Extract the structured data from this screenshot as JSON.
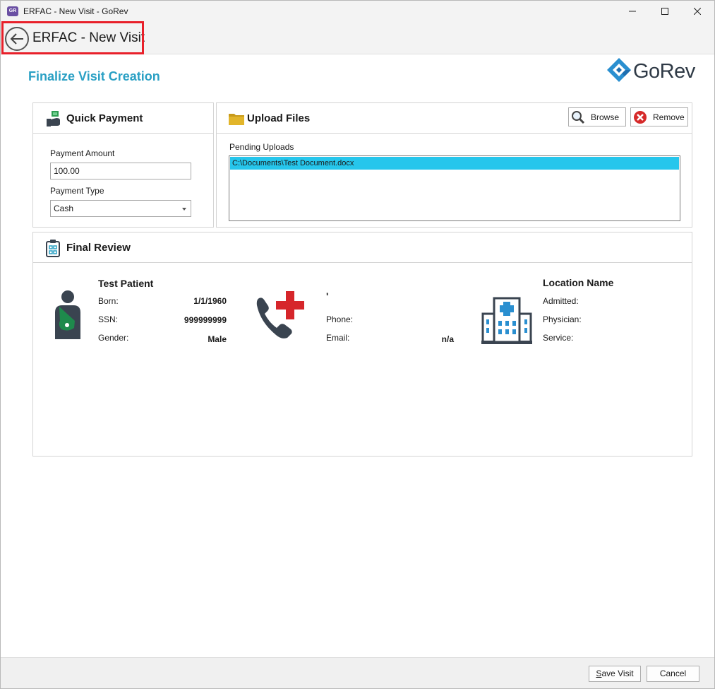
{
  "window": {
    "title": "ERFAC - New Visit - GoRev",
    "app_icon_text": "GR"
  },
  "header": {
    "nav_title": "ERFAC - New Visit"
  },
  "page": {
    "heading": "Finalize Visit Creation",
    "logo_text": "GoRev"
  },
  "quick_payment": {
    "title": "Quick Payment",
    "amount_label": "Payment Amount",
    "amount_value": "100.00",
    "type_label": "Payment Type",
    "type_value": "Cash"
  },
  "upload_files": {
    "title": "Upload Files",
    "browse_label": "Browse",
    "remove_label": "Remove",
    "pending_label": "Pending Uploads",
    "files": [
      "C:\\Documents\\Test Document.docx"
    ]
  },
  "final_review": {
    "title": "Final Review",
    "patient": {
      "name": "Test Patient",
      "born_label": "Born:",
      "born_value": "1/1/1960",
      "ssn_label": "SSN:",
      "ssn_value": "999999999",
      "gender_label": "Gender:",
      "gender_value": "Male"
    },
    "contact": {
      "address": "'",
      "phone_label": "Phone:",
      "phone_value": "",
      "email_label": "Email:",
      "email_value": "n/a"
    },
    "location": {
      "name": "Location Name",
      "admitted_label": "Admitted:",
      "physician_label": "Physician:",
      "service_label": "Service:"
    }
  },
  "footer": {
    "save_prefix": "S",
    "save_rest": "ave Visit",
    "cancel_label": "Cancel"
  },
  "colors": {
    "accent": "#2aa0c4",
    "selection": "#26c6ec",
    "highlight": "#e8202a",
    "medical_red": "#d6262b",
    "icon_dark": "#3a4450",
    "sling_green": "#1e8a4c"
  }
}
